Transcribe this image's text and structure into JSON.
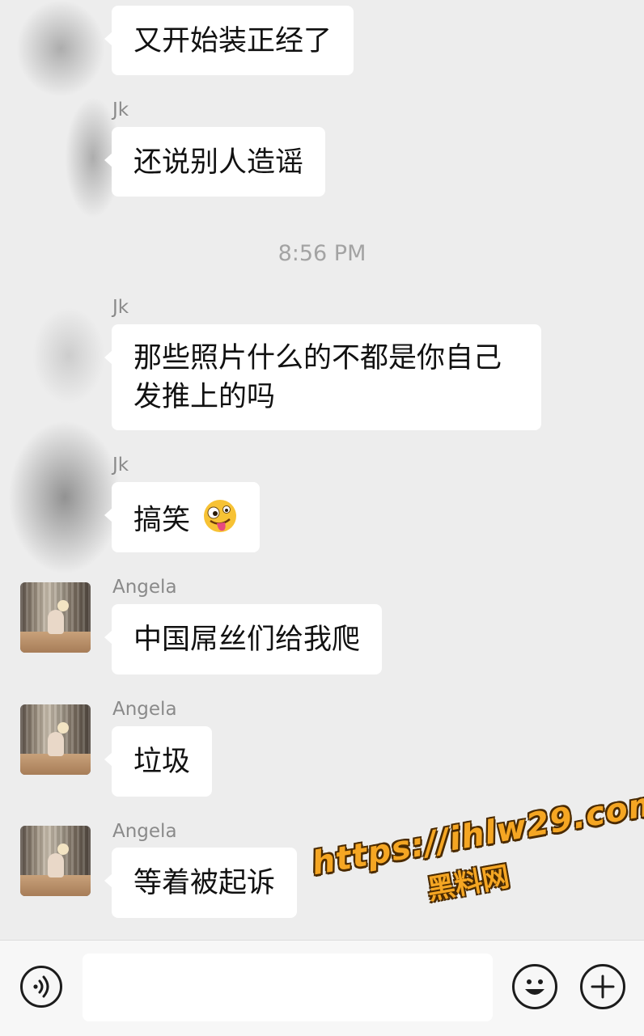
{
  "chat": {
    "timestamp": "8:56 PM",
    "messages": [
      {
        "sender": "",
        "text": "又开始装正经了"
      },
      {
        "sender": "Jk",
        "text": "还说别人造谣"
      },
      {
        "sender": "Jk",
        "line1": "那些照片什么的不都是你自己",
        "line2": "发推上的吗"
      },
      {
        "sender": "Jk",
        "text": "搞笑",
        "emoji": "zany-face-emoji"
      },
      {
        "sender": "Angela",
        "text": "中国屌丝们给我爬"
      },
      {
        "sender": "Angela",
        "text": "垃圾"
      },
      {
        "sender": "Angela",
        "text": "等着被起诉"
      }
    ]
  },
  "watermark": {
    "url": "https://ihlw29.com",
    "name": "黑料网"
  },
  "input_bar": {
    "icons": [
      "voice-icon",
      "emoji-icon",
      "plus-icon"
    ],
    "text": ""
  }
}
